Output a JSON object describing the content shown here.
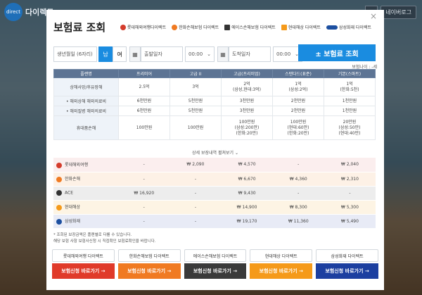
{
  "topbar": {
    "brand_logo": "direct",
    "brand": "다이렉트",
    "btn": "네이버로그"
  },
  "modal": {
    "title": "보험료 조회",
    "close": "×"
  },
  "logos": [
    {
      "name": "롯데해외여행다이렉트",
      "color": "#d43c2c"
    },
    {
      "name": "한화손해보험 다이렉트",
      "color": "#f07a22"
    },
    {
      "name": "에이스손해보험 다이렉트",
      "color": "#333333"
    },
    {
      "name": "현대해상 다이렉트",
      "color": "#f59a1a"
    },
    {
      "name": "삼성화재 다이렉트",
      "color": "#1c4fa0"
    }
  ],
  "form": {
    "birth_placeholder": "생년월일 (6자리)",
    "male": "남",
    "female": "여",
    "depart_placeholder": "출발일자",
    "depart_time": "00:00",
    "arrive_placeholder": "도착일자",
    "arrive_time": "00:00",
    "search": "± 보험료 조회"
  },
  "unit": "보험나이 : -세",
  "coverage": {
    "headers": [
      "플랜명",
      "프리미어",
      "고급 II",
      "고급(프리미엄)",
      "스탠다드(표준)",
      "기본(스마트)"
    ],
    "rows": [
      {
        "label": "상해사망/후유장해",
        "vals": [
          "2.5억",
          "3억",
          "2억\n(삼성,현대:3억)",
          "1억\n(삼성:2억)",
          "1억\n(한화:5천)"
        ]
      },
      {
        "label": "• 해외상해 해외의료비",
        "vals": [
          "6천만원",
          "5천만원",
          "3천만원",
          "2천만원",
          "1천만원"
        ]
      },
      {
        "label": "• 해외질병 해외의료비",
        "vals": [
          "6천만원",
          "5천만원",
          "3천만원",
          "2천만원",
          "1천만원"
        ]
      },
      {
        "label": "휴대품손해",
        "vals": [
          "100만원",
          "100만원",
          "100만원\n(삼성:200만)\n(한화:20만)",
          "100만원\n(현대:60만)\n(한화:20만)",
          "20만원\n(삼성:50만)\n(현대:40만)"
        ]
      }
    ]
  },
  "more": "상세 보장내역 펼쳐보기 ⌄",
  "prices": [
    {
      "name": "롯데해외여행",
      "bg": "#fbeeee",
      "dot": "#d43c2c",
      "vals": [
        "-",
        "₩ 2,090",
        "₩ 4,570",
        "-",
        "₩ 2,040"
      ]
    },
    {
      "name": "한화손해",
      "bg": "#fdf1e6",
      "dot": "#f07a22",
      "vals": [
        "-",
        "-",
        "₩ 6,670",
        "₩ 4,360",
        "₩ 2,310"
      ]
    },
    {
      "name": "ACE",
      "bg": "#ededed",
      "dot": "#333333",
      "vals": [
        "₩ 16,920",
        "-",
        "₩ 9,430",
        "-",
        "-"
      ]
    },
    {
      "name": "현대해상",
      "bg": "#fdf4e4",
      "dot": "#f59a1a",
      "vals": [
        "-",
        "-",
        "₩ 14,900",
        "₩ 8,300",
        "₩ 5,300"
      ]
    },
    {
      "name": "삼성화재",
      "bg": "#e8ebf6",
      "dot": "#1c4fa0",
      "vals": [
        "-",
        "-",
        "₩ 19,170",
        "₩ 11,360",
        "₩ 5,490"
      ]
    }
  ],
  "notes": [
    "* 조회된 보장금액은 플랜별로 다를 수 있습니다.",
    "해당 보험 사항 보험사신청 시 직접확인 보험료확인을 바랍니다."
  ],
  "cards": [
    {
      "name": "롯데해외여행 다이렉트",
      "btn": "보험신청 바로가기 →",
      "color": "#e03a2a"
    },
    {
      "name": "한화손해보험 다이렉트",
      "btn": "보험신청 바로가기 →",
      "color": "#f07a22"
    },
    {
      "name": "에이스손해보험 다이렉트",
      "btn": "보험신청 바로가기 →",
      "color": "#3a3a3a"
    },
    {
      "name": "현대해상 다이렉트",
      "btn": "보험신청 바로가기 →",
      "color": "#f59a1a"
    },
    {
      "name": "삼성화재 다이렉트",
      "btn": "보험신청 바로가기 →",
      "color": "#1c3fa0"
    }
  ]
}
